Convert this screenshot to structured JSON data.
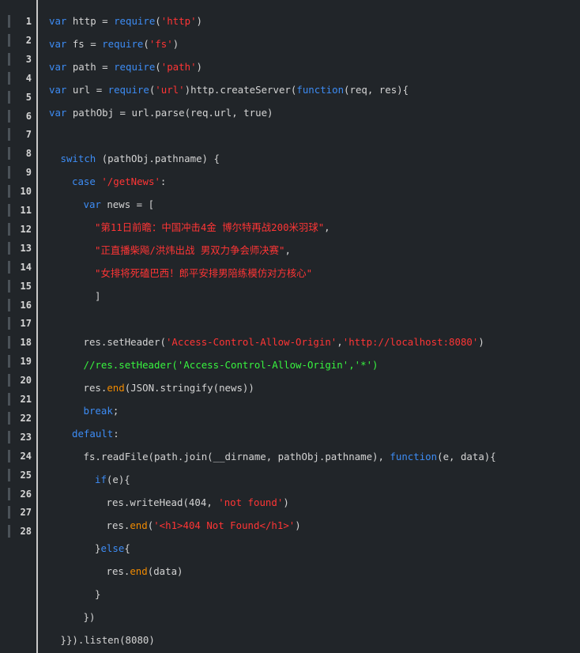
{
  "editor": {
    "line_numbers": [
      "1",
      "2",
      "3",
      "4",
      "5",
      "6",
      "7",
      "8",
      "9",
      "10",
      "11",
      "12",
      "13",
      "14",
      "15",
      "16",
      "17",
      "18",
      "19",
      "20",
      "21",
      "22",
      "23",
      "24",
      "25",
      "26",
      "27",
      "28"
    ],
    "code_lines": [
      {
        "indent": 0,
        "tokens": [
          {
            "t": "var",
            "c": "kw"
          },
          {
            "t": " http = ",
            "c": "txt"
          },
          {
            "t": "require",
            "c": "kw"
          },
          {
            "t": "(",
            "c": "txt"
          },
          {
            "t": "'http'",
            "c": "str"
          },
          {
            "t": ")",
            "c": "txt"
          }
        ]
      },
      {
        "indent": 0,
        "tokens": [
          {
            "t": "var",
            "c": "kw"
          },
          {
            "t": " fs = ",
            "c": "txt"
          },
          {
            "t": "require",
            "c": "kw"
          },
          {
            "t": "(",
            "c": "txt"
          },
          {
            "t": "'fs'",
            "c": "str"
          },
          {
            "t": ")",
            "c": "txt"
          }
        ]
      },
      {
        "indent": 0,
        "tokens": [
          {
            "t": "var",
            "c": "kw"
          },
          {
            "t": " path = ",
            "c": "txt"
          },
          {
            "t": "require",
            "c": "kw"
          },
          {
            "t": "(",
            "c": "txt"
          },
          {
            "t": "'path'",
            "c": "str"
          },
          {
            "t": ")",
            "c": "txt"
          }
        ]
      },
      {
        "indent": 0,
        "tokens": [
          {
            "t": "var",
            "c": "kw"
          },
          {
            "t": " url = ",
            "c": "txt"
          },
          {
            "t": "require",
            "c": "kw"
          },
          {
            "t": "(",
            "c": "txt"
          },
          {
            "t": "'url'",
            "c": "str"
          },
          {
            "t": ")http.createServer(",
            "c": "txt"
          },
          {
            "t": "function",
            "c": "kw"
          },
          {
            "t": "(req, res){",
            "c": "txt"
          }
        ]
      },
      {
        "indent": 0,
        "tokens": [
          {
            "t": "var",
            "c": "kw"
          },
          {
            "t": " pathObj = url.parse(req.url, true)",
            "c": "txt"
          }
        ]
      },
      {
        "indent": 0,
        "tokens": []
      },
      {
        "indent": 1,
        "tokens": [
          {
            "t": "switch",
            "c": "kw"
          },
          {
            "t": " (pathObj.pathname) {",
            "c": "txt"
          }
        ]
      },
      {
        "indent": 2,
        "tokens": [
          {
            "t": "case",
            "c": "kw"
          },
          {
            "t": " ",
            "c": "txt"
          },
          {
            "t": "'/getNews'",
            "c": "str"
          },
          {
            "t": ":",
            "c": "txt"
          }
        ]
      },
      {
        "indent": 3,
        "tokens": [
          {
            "t": "var",
            "c": "kw"
          },
          {
            "t": " news = [",
            "c": "txt"
          }
        ]
      },
      {
        "indent": 4,
        "tokens": [
          {
            "t": "\"第11日前瞻：中国冲击4金 博尔特再战200米羽球\"",
            "c": "str"
          },
          {
            "t": ",",
            "c": "txt"
          }
        ]
      },
      {
        "indent": 4,
        "tokens": [
          {
            "t": "\"正直播柴飚/洪炜出战 男双力争会师决赛\"",
            "c": "str"
          },
          {
            "t": ",",
            "c": "txt"
          }
        ]
      },
      {
        "indent": 4,
        "tokens": [
          {
            "t": "\"女排将死磕巴西！郎平安排男陪练模仿对方核心\"",
            "c": "str"
          }
        ]
      },
      {
        "indent": 4,
        "tokens": [
          {
            "t": "]",
            "c": "txt"
          }
        ]
      },
      {
        "indent": 0,
        "tokens": []
      },
      {
        "indent": 3,
        "tokens": [
          {
            "t": "res.setHeader(",
            "c": "txt"
          },
          {
            "t": "'Access-Control-Allow-Origin'",
            "c": "str"
          },
          {
            "t": ",",
            "c": "txt"
          },
          {
            "t": "'http://localhost:8080'",
            "c": "str"
          },
          {
            "t": ")",
            "c": "txt"
          }
        ]
      },
      {
        "indent": 3,
        "tokens": [
          {
            "t": "//res.setHeader('Access-Control-Allow-Origin','*')",
            "c": "cmt"
          }
        ]
      },
      {
        "indent": 3,
        "tokens": [
          {
            "t": "res.",
            "c": "txt"
          },
          {
            "t": "end",
            "c": "fn"
          },
          {
            "t": "(JSON.stringify(news))",
            "c": "txt"
          }
        ]
      },
      {
        "indent": 3,
        "tokens": [
          {
            "t": "break",
            "c": "kw"
          },
          {
            "t": ";",
            "c": "txt"
          }
        ]
      },
      {
        "indent": 2,
        "tokens": [
          {
            "t": "default",
            "c": "kw"
          },
          {
            "t": ":",
            "c": "txt"
          }
        ]
      },
      {
        "indent": 3,
        "tokens": [
          {
            "t": "fs.readFile(path.join(__dirname, pathObj.pathname), ",
            "c": "txt"
          },
          {
            "t": "function",
            "c": "kw"
          },
          {
            "t": "(e, data){",
            "c": "txt"
          }
        ]
      },
      {
        "indent": 4,
        "tokens": [
          {
            "t": "if",
            "c": "kw"
          },
          {
            "t": "(e){",
            "c": "txt"
          }
        ]
      },
      {
        "indent": 5,
        "tokens": [
          {
            "t": "res.writeHead(404, ",
            "c": "txt"
          },
          {
            "t": "'not found'",
            "c": "str"
          },
          {
            "t": ")",
            "c": "txt"
          }
        ]
      },
      {
        "indent": 5,
        "tokens": [
          {
            "t": "res.",
            "c": "txt"
          },
          {
            "t": "end",
            "c": "fn"
          },
          {
            "t": "(",
            "c": "txt"
          },
          {
            "t": "'<h1>404 Not Found</h1>'",
            "c": "str"
          },
          {
            "t": ")",
            "c": "txt"
          }
        ]
      },
      {
        "indent": 4,
        "tokens": [
          {
            "t": "}",
            "c": "txt"
          },
          {
            "t": "else",
            "c": "kw"
          },
          {
            "t": "{",
            "c": "txt"
          }
        ]
      },
      {
        "indent": 5,
        "tokens": [
          {
            "t": "res.",
            "c": "txt"
          },
          {
            "t": "end",
            "c": "fn"
          },
          {
            "t": "(data)",
            "c": "txt"
          }
        ]
      },
      {
        "indent": 4,
        "tokens": [
          {
            "t": "}",
            "c": "txt"
          }
        ]
      },
      {
        "indent": 3,
        "tokens": [
          {
            "t": "})",
            "c": "txt"
          }
        ]
      },
      {
        "indent": 1,
        "tokens": [
          {
            "t": "}}).listen(8080)",
            "c": "txt"
          }
        ]
      }
    ]
  },
  "colors": {
    "background": "#212529",
    "keyword": "#3d8cf4",
    "string": "#ff3535",
    "comment": "#38f33f",
    "function": "#f08a00",
    "text": "#d4d4d4",
    "line_number": "#d6d6d6"
  }
}
